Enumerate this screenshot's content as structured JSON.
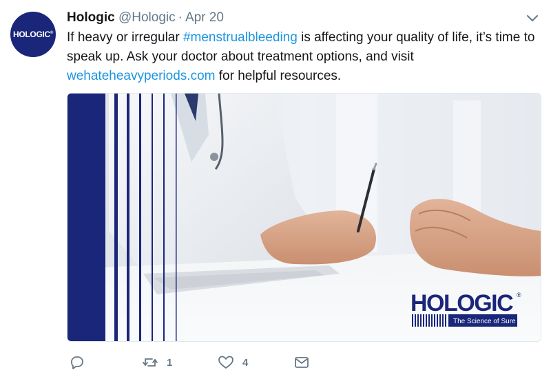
{
  "tweet": {
    "avatar": {
      "text": "HOLOGIC",
      "mark": "®"
    },
    "display_name": "Hologic",
    "handle": "@Hologic",
    "separator": "·",
    "time": "Apr 20",
    "text_parts": {
      "p1": "If heavy or irregular ",
      "hashtag": "#menstrualbleeding",
      "p2": " is affecting your quality of life, it’s time to speak up. Ask your doctor about treatment options, and visit ",
      "link": "wehateheavyperiods.com",
      "p3": " for helpful resources."
    },
    "media": {
      "brand_logo": "HOLOGIC",
      "brand_mark": "®",
      "tagline": "The Science of Sure"
    },
    "actions": {
      "reply": {
        "icon": "reply-icon"
      },
      "retweet": {
        "icon": "retweet-icon",
        "count": "1"
      },
      "like": {
        "icon": "heart-icon",
        "count": "4"
      },
      "dm": {
        "icon": "envelope-icon"
      }
    },
    "colors": {
      "brand_navy": "#1a2679",
      "link_blue": "#1b95e0",
      "muted_gray": "#657786"
    }
  }
}
